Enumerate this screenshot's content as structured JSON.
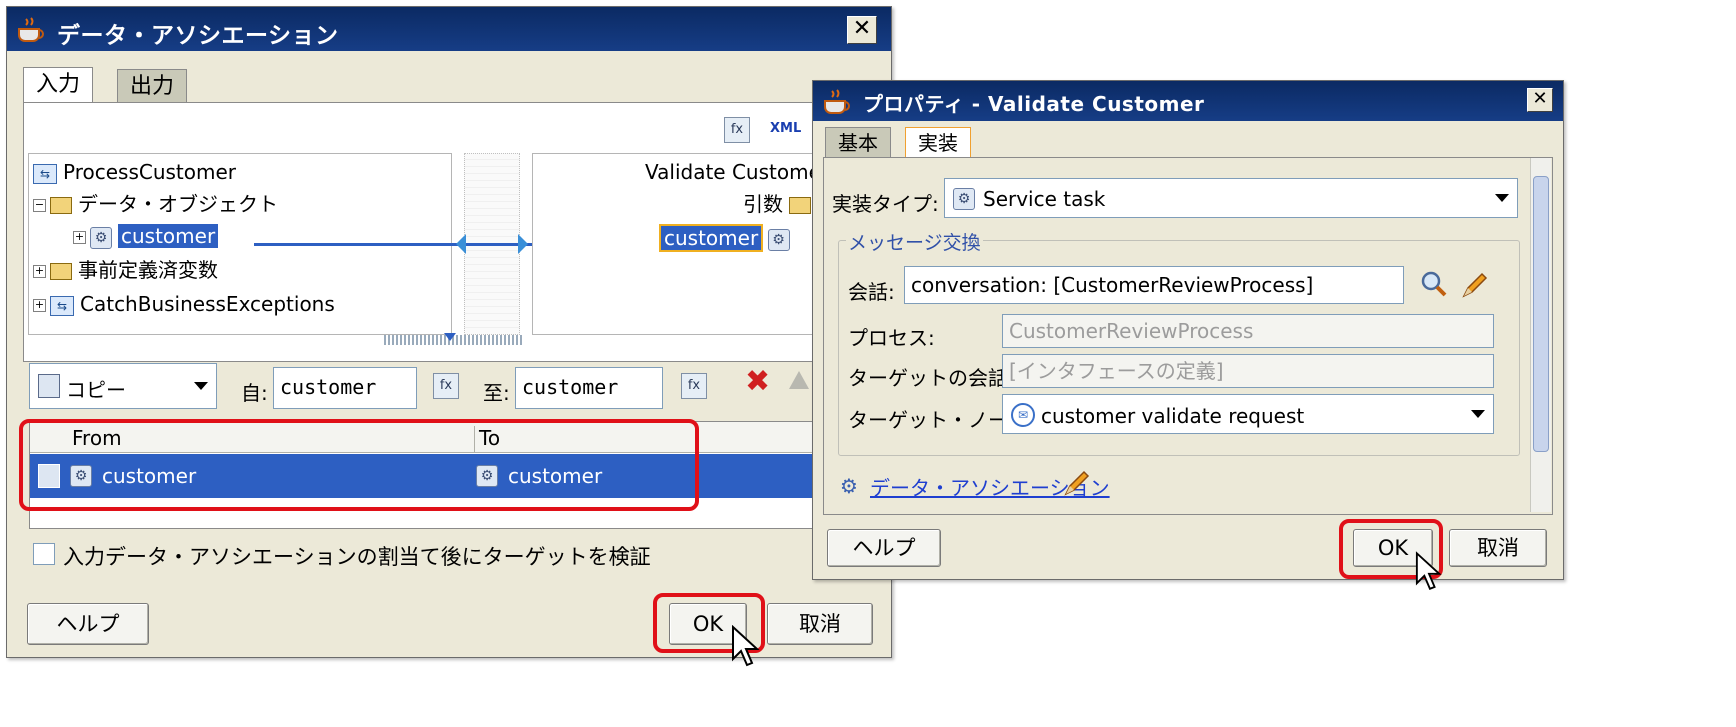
{
  "left_dialog": {
    "title": "データ・アソシエーション",
    "close_label": "✕",
    "tabs": [
      {
        "label": "入力"
      },
      {
        "label": "出力"
      }
    ],
    "source_tree": {
      "root": "ProcessCustomer",
      "items": [
        {
          "label": "データ・オブジェクト"
        },
        {
          "label": "customer"
        },
        {
          "label": "事前定義済変数"
        },
        {
          "label": "CatchBusinessExceptions"
        }
      ]
    },
    "target_tree": {
      "root": "Validate Custome",
      "args_label": "引数",
      "item": "customer"
    },
    "copy_combo": "コピー",
    "from_label": "自:",
    "from_value": "customer",
    "to_label": "至:",
    "to_value": "customer",
    "table": {
      "headers": [
        "From",
        "To"
      ],
      "rows": [
        {
          "from": "customer",
          "to": "customer"
        }
      ]
    },
    "validate_checkbox_label": "入力データ・アソシエーションの割当て後にターゲットを検証",
    "help_label": "ヘルプ",
    "ok_label": "OK",
    "cancel_label": "取消"
  },
  "right_dialog": {
    "title": "プロパティ - Validate Customer",
    "close_label": "✕",
    "tabs": [
      {
        "label": "基本"
      },
      {
        "label": "実装"
      }
    ],
    "impl_type_label": "実装タイプ:",
    "impl_type_value": "Service task",
    "message_exchange_label": "メッセージ交換",
    "conversation_label": "会話:",
    "conversation_value": "conversation: [CustomerReviewProcess]",
    "process_label": "プロセス:",
    "process_value": "CustomerReviewProcess",
    "target_conversation_label": "ターゲットの会話:",
    "target_conversation_value": "[インタフェースの定義]",
    "target_node_label": "ターゲット・ノード:",
    "target_node_value": "customer validate request",
    "data_association_link": "データ・アソシエーション",
    "help_label": "ヘルプ",
    "ok_label": "OK",
    "cancel_label": "取消"
  },
  "colors": {
    "titlebar": "#0b2a63",
    "selection": "#2d5fc2",
    "highlight_box": "#e01018",
    "dialog_bg": "#ece9d8"
  }
}
